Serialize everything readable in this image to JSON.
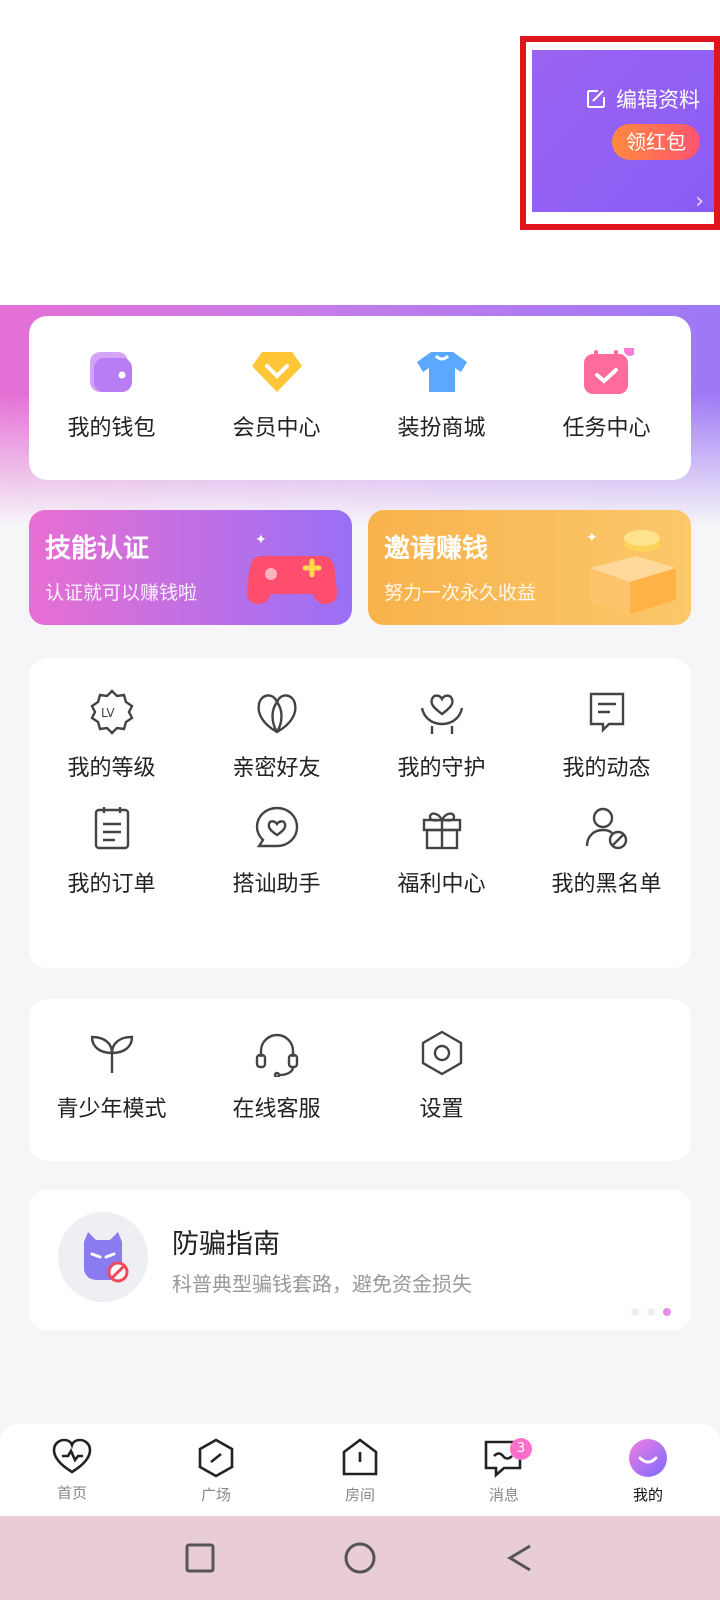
{
  "profile": {
    "edit_label": "编辑资料",
    "red_packet_label": "领红包",
    "chevron": "›"
  },
  "quick_menu": [
    {
      "label": "我的钱包",
      "icon": "wallet-icon",
      "color": "#b97cf3"
    },
    {
      "label": "会员中心",
      "icon": "vip-diamond-icon",
      "color": "#ffc637"
    },
    {
      "label": "装扮商城",
      "icon": "tshirt-icon",
      "color": "#5aa8ff"
    },
    {
      "label": "任务中心",
      "icon": "calendar-check-icon",
      "color": "#ff6b9b"
    }
  ],
  "promos": [
    {
      "title": "技能认证",
      "subtitle": "认证就可以赚钱啦"
    },
    {
      "title": "邀请赚钱",
      "subtitle": "努力一次永久收益"
    }
  ],
  "features": [
    {
      "label": "我的等级",
      "icon": "level-badge-icon"
    },
    {
      "label": "亲密好友",
      "icon": "intimate-friend-icon"
    },
    {
      "label": "我的守护",
      "icon": "guardian-heart-icon"
    },
    {
      "label": "我的动态",
      "icon": "feed-note-icon"
    },
    {
      "label": "我的订单",
      "icon": "order-list-icon"
    },
    {
      "label": "搭讪助手",
      "icon": "chat-heart-icon"
    },
    {
      "label": "福利中心",
      "icon": "gift-icon"
    },
    {
      "label": "我的黑名单",
      "icon": "blocked-user-icon"
    }
  ],
  "settings": [
    {
      "label": "青少年模式",
      "icon": "sprout-icon"
    },
    {
      "label": "在线客服",
      "icon": "headset-icon"
    },
    {
      "label": "设置",
      "icon": "settings-hexagon-icon"
    }
  ],
  "fraud": {
    "title": "防骗指南",
    "subtitle": "科普典型骗钱套路，避免资金损失"
  },
  "nav": {
    "items": [
      {
        "label": "首页",
        "icon": "heartbeat-icon"
      },
      {
        "label": "广场",
        "icon": "compass-hex-icon"
      },
      {
        "label": "房间",
        "icon": "room-house-icon"
      },
      {
        "label": "消息",
        "icon": "message-icon",
        "badge": "3"
      },
      {
        "label": "我的",
        "icon": "avatar-icon"
      }
    ]
  },
  "colors": {
    "accent_purple": "#8a5cf5",
    "accent_pink": "#e56fd4",
    "highlight_border": "#e0161e"
  }
}
